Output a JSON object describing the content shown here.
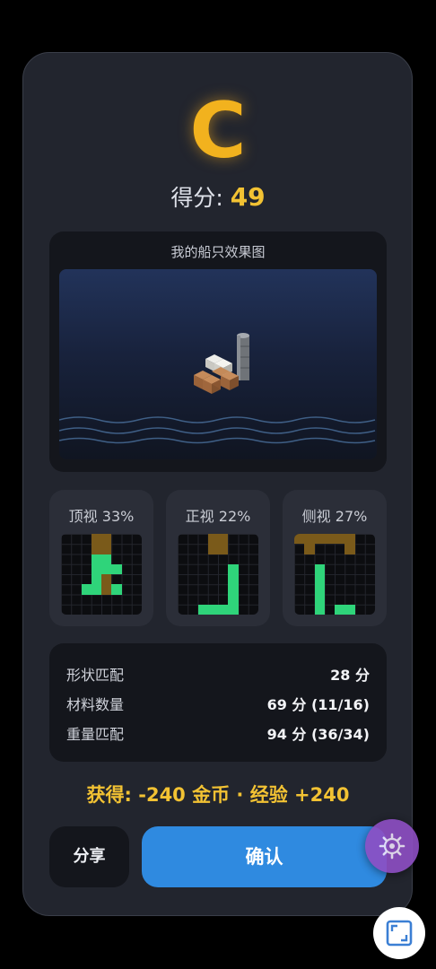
{
  "result": {
    "grade": "C",
    "score_label": "得分:",
    "score_value": "49"
  },
  "preview": {
    "title": "我的船只效果图"
  },
  "views": [
    {
      "label": "顶视 33%"
    },
    {
      "label": "正视 22%"
    },
    {
      "label": "侧视 27%"
    }
  ],
  "stats": [
    {
      "label": "形状匹配",
      "value": "28 分"
    },
    {
      "label": "材料数量",
      "value": "69 分 (11/16)"
    },
    {
      "label": "重量匹配",
      "value": "94 分 (36/34)"
    }
  ],
  "reward": {
    "text": "获得: -240 金币 · 经验 +240"
  },
  "buttons": {
    "share": "分享",
    "confirm": "确认"
  },
  "icons": {
    "settings": "gear-icon",
    "corner": "frame-icon"
  },
  "colors": {
    "grade": "#f2b21e",
    "confirm": "#2f8ae0",
    "settings_fab": "#8e4fc4",
    "match": "#2fd47a",
    "target": "#7a5a1a"
  }
}
